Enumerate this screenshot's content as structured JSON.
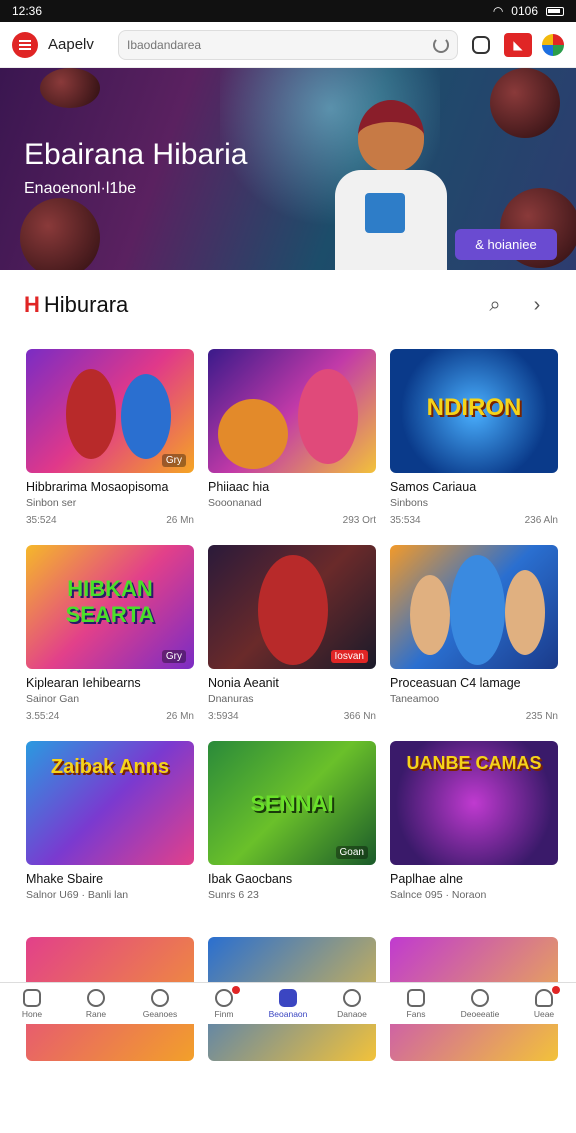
{
  "status": {
    "time": "12:36",
    "battery": "0106"
  },
  "topbar": {
    "brand": "Aapelv",
    "search_placeholder": "Ibaodandarea"
  },
  "hero": {
    "title": "Ebairana Hibaria",
    "subtitle": "Enaoenonl·l1be",
    "button": "& hoianiee"
  },
  "section": {
    "logo": "H",
    "title": "Hiburara"
  },
  "cards": [
    {
      "title": "Hibbrarima Mosaopisoma",
      "sub": "Sinbon ser",
      "date": "35:524",
      "size": "26 Mn",
      "badge": "Gry"
    },
    {
      "title": "Phiiaac hia",
      "sub": "Sooonanad",
      "date": "",
      "size": "293 Ort",
      "badge": ""
    },
    {
      "title": "Samos Cariaua",
      "sub": "Sinbons",
      "date": "35:534",
      "size": "236 Aln",
      "badge": "",
      "art": "NDIRON"
    },
    {
      "title": "Kiplearan Iehibearns",
      "sub": "Sainor Gan",
      "date": "3.55:24",
      "size": "26 Mn",
      "badge": "Gry",
      "art": "HIBKAN SEARTA"
    },
    {
      "title": "Nonia Aeanit",
      "sub": "Dnanuras",
      "date": "3:5934",
      "size": "366 Nn",
      "badge": "Iosvan"
    },
    {
      "title": "Proceasuan C4 lamage",
      "sub": "Taneamoo",
      "date": "",
      "size": "235 Nn",
      "badge": ""
    },
    {
      "title": "Mhake Sbaire",
      "sub": "Salnor U69 · Banli lan",
      "date": "",
      "size": "",
      "badge": "",
      "art": "Zaibak Anns"
    },
    {
      "title": "Ibak Gaocbans",
      "sub": "Sunrs 6 23",
      "date": "",
      "size": "",
      "badge": "Goan",
      "art": "SENNAI"
    },
    {
      "title": "Paplhae alne",
      "sub": "Salnce 095 · Noraon",
      "date": "",
      "size": "",
      "badge": "",
      "art": "UANBE CAMAS"
    }
  ],
  "nav": [
    {
      "label": "Hone"
    },
    {
      "label": "Rane"
    },
    {
      "label": "Geanoes"
    },
    {
      "label": "Finm"
    },
    {
      "label": "Beoanaon"
    },
    {
      "label": "Danaoe"
    },
    {
      "label": "Fans"
    },
    {
      "label": "Deoeeatie"
    },
    {
      "label": "Ueae"
    }
  ],
  "colors": {
    "accent": "#e02525",
    "hero_button": "#6a4bd1",
    "nav_active": "#3b46c2"
  }
}
